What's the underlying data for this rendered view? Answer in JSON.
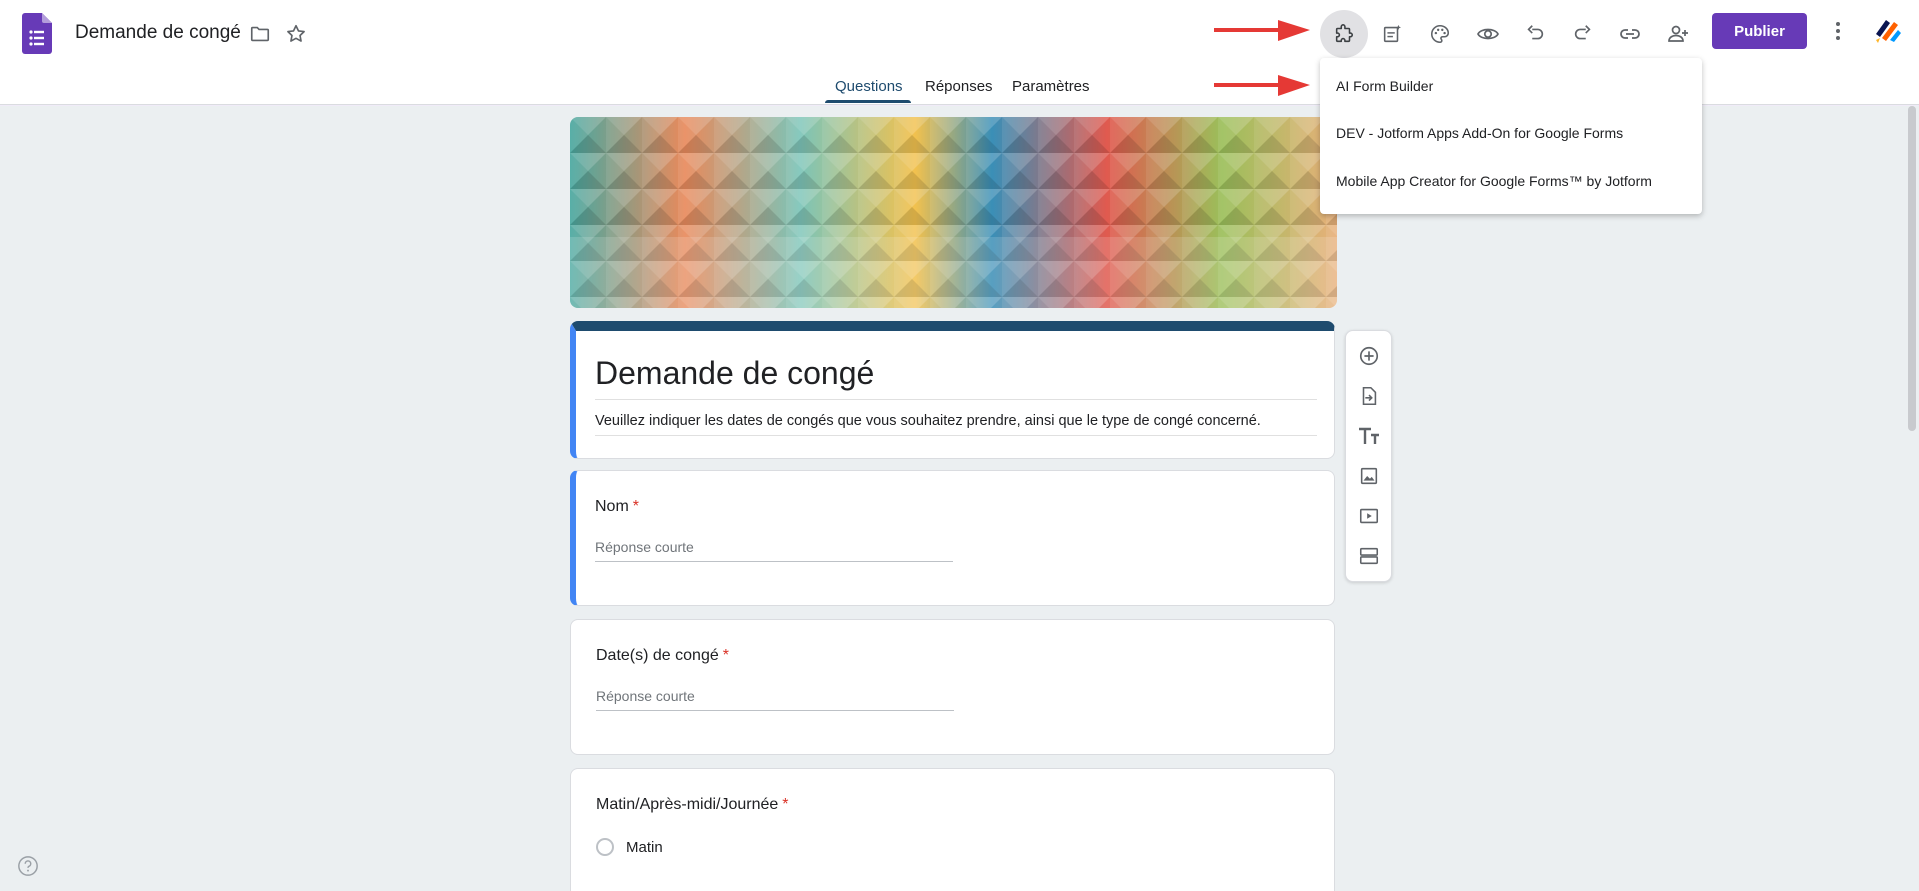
{
  "header": {
    "doc_title": "Demande de congé",
    "publish_label": "Publier"
  },
  "tabs": [
    {
      "label": "Questions"
    },
    {
      "label": "Réponses"
    },
    {
      "label": "Paramètres"
    }
  ],
  "addons_menu": {
    "items": [
      {
        "label": "AI Form Builder"
      },
      {
        "label": "DEV - Jotform Apps Add-On for Google Forms"
      },
      {
        "label": "Mobile App Creator for Google Forms™ by Jotform"
      }
    ]
  },
  "form": {
    "title": "Demande de congé",
    "description": "Veuillez indiquer les dates de congés que vous souhaitez prendre, ainsi que le type de congé concerné.",
    "questions": [
      {
        "label": "Nom",
        "required_mark": "*",
        "placeholder": "Réponse courte"
      },
      {
        "label": "Date(s) de congé",
        "required_mark": "*",
        "placeholder": "Réponse courte"
      },
      {
        "label": "Matin/Après-midi/Journée",
        "required_mark": "*",
        "option": "Matin"
      }
    ]
  },
  "colors": {
    "accent": "#673ab7",
    "theme": "#1e4b6e",
    "selected_border": "#4285f4",
    "arrow": "#e53935"
  }
}
